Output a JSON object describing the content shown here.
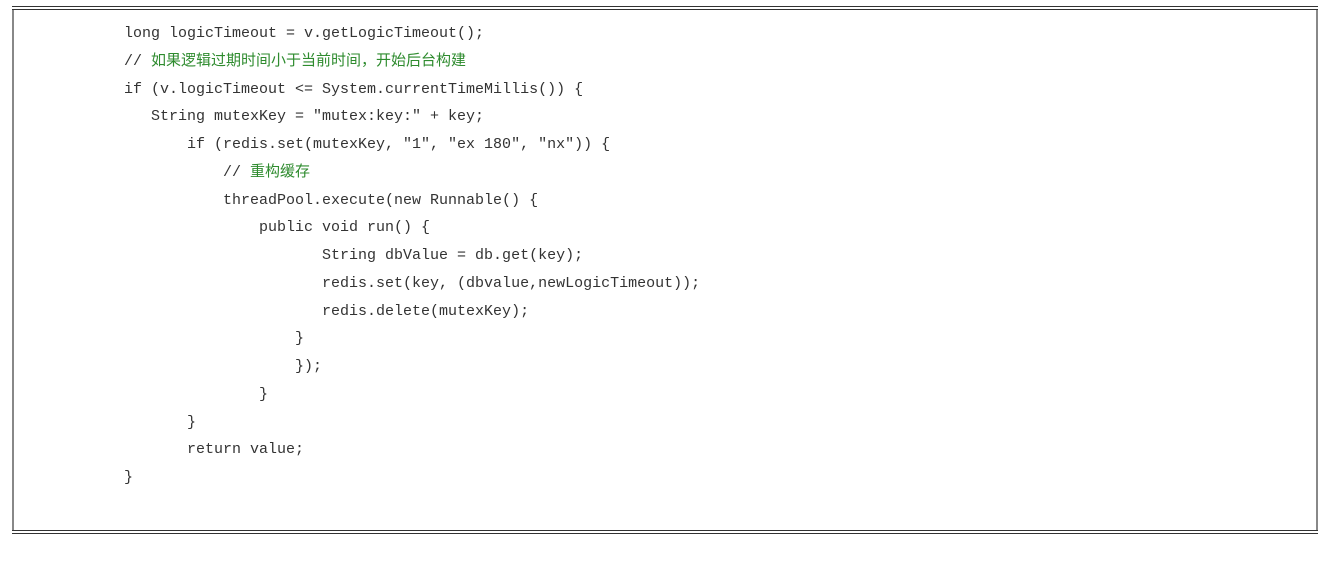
{
  "code": {
    "l1": "long logicTimeout = v.getLogicTimeout();",
    "l2a": "// ",
    "l2b": "如果逻辑过期时间小于当前时间，开始后台构建",
    "l3": "if (v.logicTimeout <= System.currentTimeMillis()) {",
    "l4": "   String mutexKey = \"mutex:key:\" + key;",
    "l5": "       if (redis.set(mutexKey, \"1\", \"ex 180\", \"nx\")) {",
    "l6a": "           // ",
    "l6b": "重构缓存",
    "l7": "           threadPool.execute(new Runnable() {",
    "l8": "               public void run() {",
    "l9": "                      String dbValue = db.get(key);",
    "l10": "                      redis.set(key, (dbvalue,newLogicTimeout));",
    "l11": "                      redis.delete(mutexKey);",
    "l12": "                   }",
    "l13": "                   });",
    "l14": "               }",
    "l15": "       }",
    "l16": "       return value;",
    "l17": "}"
  }
}
